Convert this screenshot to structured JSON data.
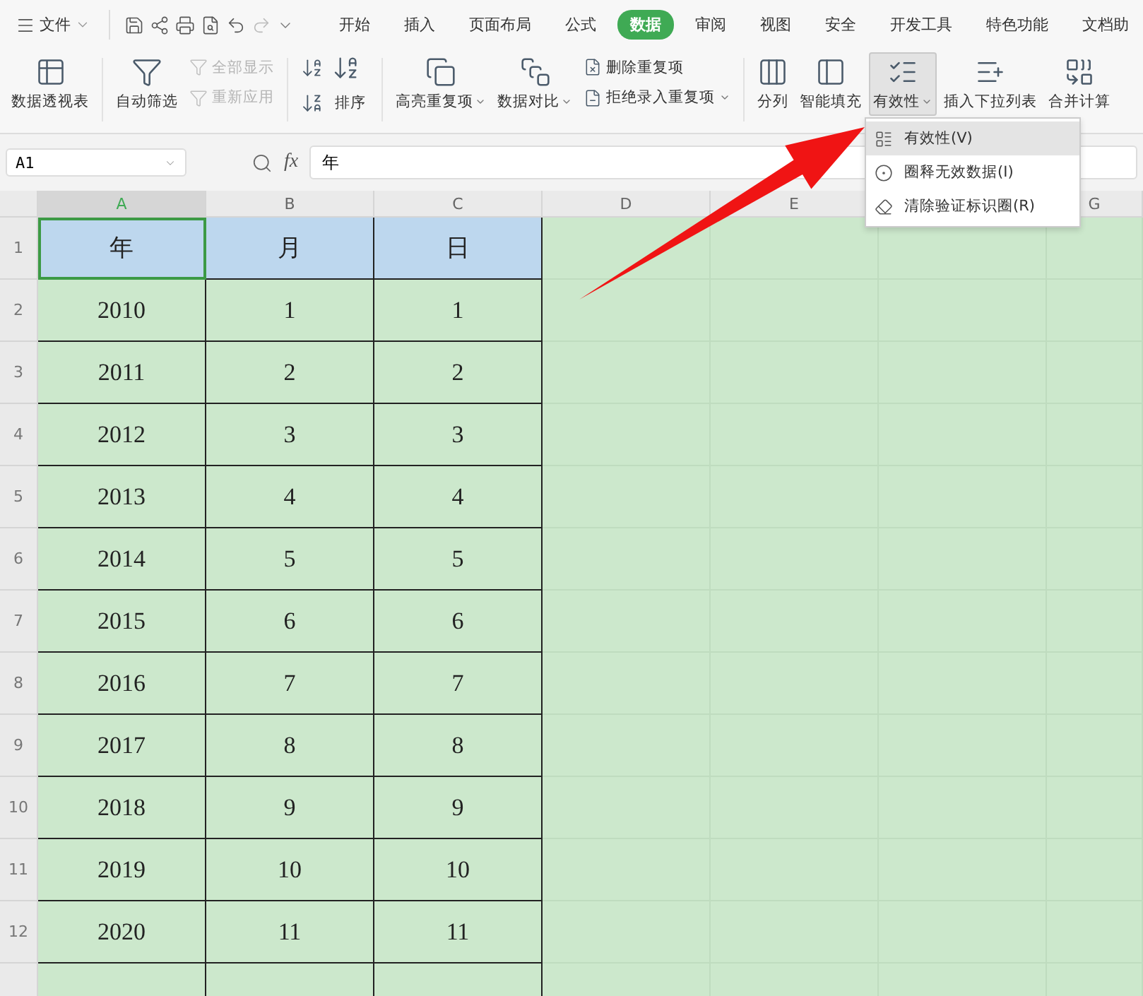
{
  "file_menu": {
    "label": "文件"
  },
  "tabs": [
    {
      "label": "开始",
      "selected": false
    },
    {
      "label": "插入",
      "selected": false
    },
    {
      "label": "页面布局",
      "selected": false
    },
    {
      "label": "公式",
      "selected": false
    },
    {
      "label": "数据",
      "selected": true
    },
    {
      "label": "审阅",
      "selected": false
    },
    {
      "label": "视图",
      "selected": false
    },
    {
      "label": "安全",
      "selected": false
    },
    {
      "label": "开发工具",
      "selected": false
    },
    {
      "label": "特色功能",
      "selected": false
    },
    {
      "label": "文档助",
      "selected": false
    }
  ],
  "ribbon": [
    {
      "kind": "large",
      "label": "数据透视表",
      "dropdown": false,
      "pressed": false
    },
    {
      "kind": "separator"
    },
    {
      "kind": "large",
      "label": "自动筛选",
      "dropdown": false,
      "pressed": false
    },
    {
      "kind": "stack",
      "items": [
        {
          "label": "全部显示",
          "disabled": true
        },
        {
          "label": "重新应用",
          "disabled": true
        }
      ]
    },
    {
      "kind": "separator"
    },
    {
      "kind": "sort",
      "label": "排序"
    },
    {
      "kind": "separator"
    },
    {
      "kind": "large",
      "label": "高亮重复项",
      "dropdown": true,
      "pressed": false
    },
    {
      "kind": "large",
      "label": "数据对比",
      "dropdown": true,
      "pressed": false
    },
    {
      "kind": "stack",
      "items": [
        {
          "label": "删除重复项",
          "disabled": false,
          "dropdown": false
        },
        {
          "label": "拒绝录入重复项",
          "disabled": false,
          "dropdown": true
        }
      ]
    },
    {
      "kind": "separator"
    },
    {
      "kind": "large",
      "label": "分列",
      "dropdown": false,
      "pressed": false
    },
    {
      "kind": "large",
      "label": "智能填充",
      "dropdown": false,
      "pressed": false
    },
    {
      "kind": "large",
      "label": "有效性",
      "dropdown": true,
      "pressed": true
    },
    {
      "kind": "large",
      "label": "插入下拉列表",
      "dropdown": false,
      "pressed": false
    },
    {
      "kind": "large",
      "label": "合并计算",
      "dropdown": false,
      "pressed": false
    }
  ],
  "dropdown_menu": [
    {
      "label": "有效性(V)",
      "selected": true
    },
    {
      "label": "圈释无效数据(I)",
      "selected": false
    },
    {
      "label": "清除验证标识圈(R)",
      "selected": false
    }
  ],
  "formula_bar": {
    "name_box": "A1",
    "fx": "fx",
    "value": "年"
  },
  "sheet": {
    "columns": [
      {
        "label": "A",
        "selected": true
      },
      {
        "label": "B",
        "selected": false
      },
      {
        "label": "C",
        "selected": false
      },
      {
        "label": "D",
        "selected": false
      },
      {
        "label": "E",
        "selected": false
      }
    ],
    "columns_right": [
      {
        "label": "G",
        "selected": false
      }
    ],
    "rows": [
      {
        "number": "1",
        "kind": "header",
        "cells": [
          "年",
          "月",
          "日"
        ]
      },
      {
        "number": "2",
        "kind": "data",
        "cells": [
          "2010",
          "1",
          "1"
        ]
      },
      {
        "number": "3",
        "kind": "data",
        "cells": [
          "2011",
          "2",
          "2"
        ]
      },
      {
        "number": "4",
        "kind": "data",
        "cells": [
          "2012",
          "3",
          "3"
        ]
      },
      {
        "number": "5",
        "kind": "data",
        "cells": [
          "2013",
          "4",
          "4"
        ]
      },
      {
        "number": "6",
        "kind": "data",
        "cells": [
          "2014",
          "5",
          "5"
        ]
      },
      {
        "number": "7",
        "kind": "data",
        "cells": [
          "2015",
          "6",
          "6"
        ]
      },
      {
        "number": "8",
        "kind": "data",
        "cells": [
          "2016",
          "7",
          "7"
        ]
      },
      {
        "number": "9",
        "kind": "data",
        "cells": [
          "2017",
          "8",
          "8"
        ]
      },
      {
        "number": "10",
        "kind": "data",
        "cells": [
          "2018",
          "9",
          "9"
        ]
      },
      {
        "number": "11",
        "kind": "data",
        "cells": [
          "2019",
          "10",
          "10"
        ]
      },
      {
        "number": "12",
        "kind": "data",
        "cells": [
          "2020",
          "11",
          "11"
        ]
      }
    ]
  }
}
